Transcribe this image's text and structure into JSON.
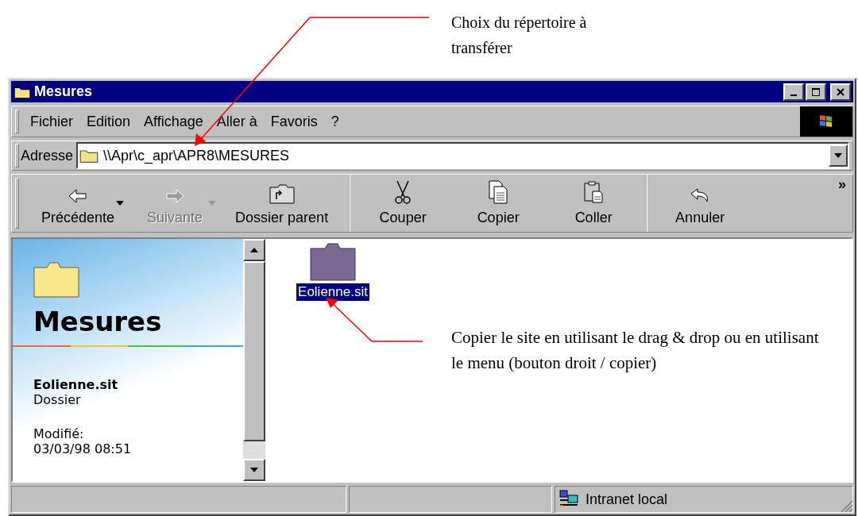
{
  "annotations": [
    {
      "text": "Choix du répertoire à transférer"
    },
    {
      "text": "Copier le site en utilisant le drag & drop ou en utilisant le menu (bouton droit / copier)"
    }
  ],
  "window": {
    "title": "Mesures"
  },
  "menu": [
    {
      "label": "Fichier"
    },
    {
      "label": "Edition"
    },
    {
      "label": "Affichage"
    },
    {
      "label": "Aller à"
    },
    {
      "label": "Favoris"
    },
    {
      "label": "?"
    }
  ],
  "address": {
    "label": "Adresse",
    "value": "\\\\Apr\\c_apr\\APR8\\MESURES"
  },
  "toolbar": {
    "buttons": [
      {
        "kind": "back",
        "label": "Précédente",
        "disabled": false,
        "dropdown": true
      },
      {
        "kind": "forward",
        "label": "Suivante",
        "disabled": true,
        "dropdown": true
      },
      {
        "kind": "up",
        "label": "Dossier parent",
        "disabled": false,
        "dropdown": false
      },
      {
        "kind": "cut",
        "label": "Couper",
        "disabled": false,
        "dropdown": false
      },
      {
        "kind": "copy",
        "label": "Copier",
        "disabled": false,
        "dropdown": false
      },
      {
        "kind": "paste",
        "label": "Coller",
        "disabled": false,
        "dropdown": false
      },
      {
        "kind": "undo",
        "label": "Annuler",
        "disabled": false,
        "dropdown": false
      }
    ],
    "more": "»"
  },
  "info_panel": {
    "title": "Mesures",
    "item_name": "Eolienne.sit",
    "item_type": "Dossier",
    "modified_label": "Modifié:",
    "modified_value": "03/03/98 08:51"
  },
  "files": [
    {
      "label": "Eolienne.sit",
      "selected": true
    }
  ],
  "status_bar": {
    "zone": "Intranet local"
  }
}
